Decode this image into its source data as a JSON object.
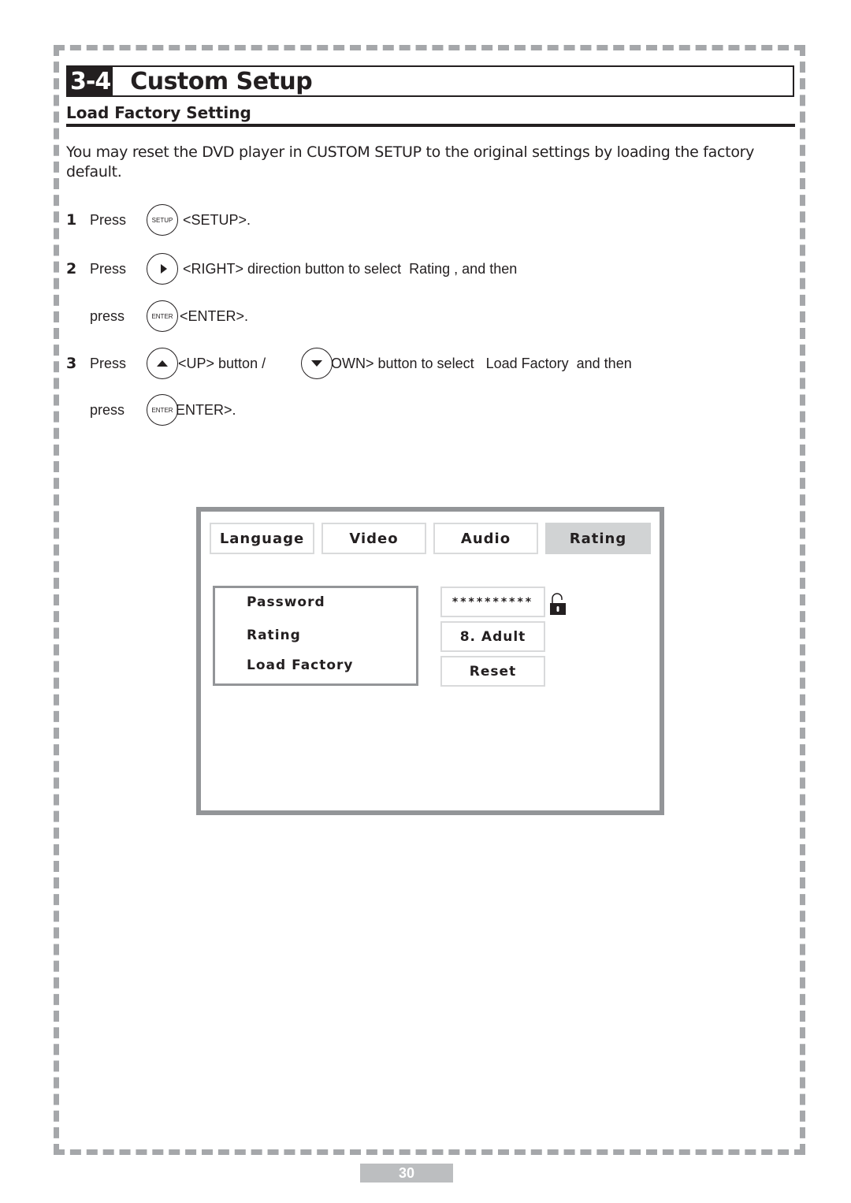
{
  "section": {
    "number": "3-4",
    "title": "Custom Setup"
  },
  "subheading": "Load Factory Setting",
  "intro": "You may reset the DVD player in CUSTOM SETUP to the original settings by loading the factory default.",
  "steps": [
    {
      "num": "1",
      "word": "Press",
      "button": {
        "icon": "setup-button-icon",
        "label": "SETUP"
      },
      "text": "<SETUP>."
    },
    {
      "num": "2",
      "word": "Press",
      "button": {
        "icon": "right-arrow-button-icon",
        "label": ""
      },
      "text": "<RIGHT> direction button to select  Rating , and then"
    },
    {
      "num": "",
      "word": "press",
      "button": {
        "icon": "enter-button-icon",
        "label": "ENTER"
      },
      "text": "<ENTER>."
    },
    {
      "num": "3",
      "word": "Press",
      "button": {
        "icon": "up-arrow-button-icon",
        "label": ""
      },
      "text": "<UP> button /",
      "button2": {
        "icon": "down-arrow-button-icon",
        "label": ""
      },
      "text2": "OWN> button to select   Load Factory  and then"
    },
    {
      "num": "",
      "word": "press",
      "button": {
        "icon": "enter-button-icon",
        "label": "ENTER"
      },
      "text": "ENTER>."
    }
  ],
  "osd": {
    "tabs": [
      {
        "label": "Language",
        "active": false
      },
      {
        "label": "Video",
        "active": false
      },
      {
        "label": "Audio",
        "active": false
      },
      {
        "label": "Rating",
        "active": true
      }
    ],
    "menu_items": [
      "Password",
      "Rating",
      "Load Factory"
    ],
    "values": {
      "password": "**********",
      "rating": "8. Adult",
      "load_factory": "Reset"
    },
    "lock_icon": "unlocked-padlock-icon"
  },
  "page_number": "30"
}
